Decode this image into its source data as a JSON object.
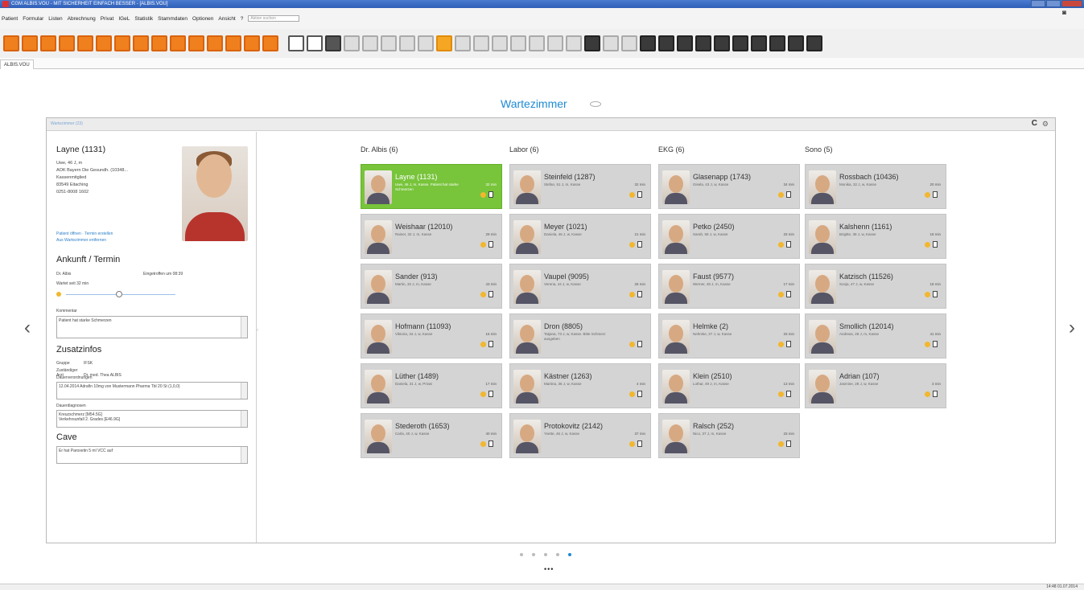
{
  "window": {
    "title": "CGM ALBIS.VOU - MIT SICHERHEIT EINFACH BESSER - [ALBIS.VOU]"
  },
  "menu": {
    "items": [
      "Patient",
      "Formular",
      "Listen",
      "Abrechnung",
      "Privat",
      "IGeL",
      "Statistik",
      "Stammdaten",
      "Optionen",
      "Ansicht",
      "?"
    ],
    "search_placeholder": "Aktion suchen"
  },
  "toolbar": {
    "icons": [
      "doc-new",
      "folder",
      "doc-list",
      "pill",
      "scale",
      "calendar",
      "aesculap",
      "glass",
      "refresh",
      "back",
      "chart",
      "calc",
      "chart-bar",
      "info",
      "clock",
      "sheet",
      "window-min",
      "window-max",
      "crosshair",
      "form-1",
      "form-2",
      "printer",
      "search-doc",
      "text-A",
      "text-ab",
      "ruler",
      "form-3",
      "form-4",
      "form-5",
      "form-6",
      "form-7",
      "form-8",
      "p-card",
      "form-9",
      "grid",
      "form-10",
      "clock-2",
      "image",
      "db",
      "photo",
      "copy",
      "map",
      "gallery",
      "drop"
    ]
  },
  "tabs": [
    "ALBIS.VOU"
  ],
  "page": {
    "title": "Wartezimmer"
  },
  "panel": {
    "title": "Wartezimmer (23)"
  },
  "patient": {
    "name": "Layne (1131)",
    "info": [
      "Uwe, 46 J, m",
      "AOK Bayern Die Gesundh. (10348...",
      "Kassenmitglied",
      "",
      "83549 Eitaching",
      "0251-8008 1602"
    ],
    "links": [
      "Patient öffnen  ·  Termin erstellen",
      "Aus Wartezimmer entfernen"
    ]
  },
  "arrival": {
    "heading": "Ankunft / Termin",
    "doctor": "Dr. Albis",
    "eingetroffen": "Eingetroffen um 08:39",
    "wait": "Wartet seit 32 min",
    "comment_label": "Kommentar",
    "comment": "Patient hat starke Schmerzen"
  },
  "extra": {
    "heading": "Zusatzinfos",
    "rows": [
      [
        "Gruppe",
        "IFSK"
      ],
      [
        "Zuständiger Arzt",
        "Dr. med. Thea ALBIS"
      ]
    ],
    "dauer_label": "Dauerverordnungen",
    "dauer": "12.04.2014 Adrafin 10mg von Mustermann Pharma Tbl 20 St (1,0,0)",
    "diag_label": "Dauerdiagnosen",
    "diag": [
      "Kreuzschmerz [M54.5G]",
      "Verkehrsunfall 2. Grades [E46.9G]"
    ]
  },
  "cave": {
    "heading": "Cave",
    "text": "Er hat Paroxetin 5 ml VCC auf"
  },
  "columns": [
    {
      "title": "Dr. Albis (6)",
      "cards": [
        {
          "name": "Layne (1131)",
          "sub": "Uwe, 46 J, m, Kasse. Patient hat starke Schmerzen",
          "wait": "32 min",
          "active": true
        },
        {
          "name": "Weishaar (12010)",
          "sub": "Rainer, 32 J, m, Kasse",
          "wait": "29 min"
        },
        {
          "name": "Sander (913)",
          "sub": "Martin, 32 J, m, Kasse",
          "wait": "43 min"
        },
        {
          "name": "Hofmann (11093)",
          "sub": "Viktoria, 34 J, w, Kasse",
          "wait": "16 min"
        },
        {
          "name": "Lüther (1489)",
          "sub": "Daniela, 31 J, w, Privat",
          "wait": "17 min"
        },
        {
          "name": "Stederoth (1653)",
          "sub": "Carla, 40 J, w, Kasse",
          "wait": "40 min"
        }
      ]
    },
    {
      "title": "Labor (6)",
      "cards": [
        {
          "name": "Steinfeld (1287)",
          "sub": "Stefan, 51 J, m, Kasse",
          "wait": "32 min"
        },
        {
          "name": "Meyer (1021)",
          "sub": "Daniela, 46 J, w, Kasse",
          "wait": "21 min"
        },
        {
          "name": "Vaupel (9095)",
          "sub": "Verena, 44 J, w, Kasse",
          "wait": "26 min"
        },
        {
          "name": "Dron (8805)",
          "sub": "Tatjana, 73 J, w, Kasse. Bitte Schmerz ausgeben",
          "wait": ""
        },
        {
          "name": "Kästner (1263)",
          "sub": "Martina, 36 J, w, Kasse",
          "wait": "4 min"
        },
        {
          "name": "Protokovitz (2142)",
          "sub": "Yvette, 46 J, w, Kasse",
          "wait": "37 min"
        }
      ]
    },
    {
      "title": "EKG (6)",
      "cards": [
        {
          "name": "Glasenapp (1743)",
          "sub": "Gisela, 43 J, w, Kasse",
          "wait": "34 min"
        },
        {
          "name": "Petko (2450)",
          "sub": "Sarah, 58 J, w, Kasse",
          "wait": "33 min"
        },
        {
          "name": "Faust (9577)",
          "sub": "Werner, 48 J, m, Kasse",
          "wait": "17 min"
        },
        {
          "name": "Helmke (2)",
          "sub": "Nehmke, 27 J, w, Kasse",
          "wait": "33 min"
        },
        {
          "name": "Klein (2510)",
          "sub": "Lothar, 49 J, m, Kasse",
          "wait": "13 min"
        },
        {
          "name": "Ralsch (252)",
          "sub": "Nico, 37 J, m, Kasse",
          "wait": "33 min"
        }
      ]
    },
    {
      "title": "Sono (5)",
      "cards": [
        {
          "name": "Rossbach (10436)",
          "sub": "Monika, 32 J, w, Kasse",
          "wait": "20 min"
        },
        {
          "name": "Kalshenn (1161)",
          "sub": "Brigitte, 38 J, w, Kasse",
          "wait": "18 min"
        },
        {
          "name": "Katzisch (11526)",
          "sub": "Sonja, 47 J, w, Kasse",
          "wait": "18 min"
        },
        {
          "name": "Smollich (12014)",
          "sub": "Andreas, 28 J, m, Kasse",
          "wait": "41 min"
        },
        {
          "name": "Adrian (107)",
          "sub": "Jasmine, 28 J, w, Kasse",
          "wait": "3 min"
        }
      ]
    }
  ],
  "pager": {
    "count": 5,
    "active": 4,
    "more": "•••"
  },
  "status": {
    "right": "14:48  01.07.2014"
  },
  "colors": {
    "accent": "#1d8bd4",
    "active_card": "#78c43b",
    "card": "#d4d4d4",
    "toolbar_orange": "#f07f1e"
  }
}
